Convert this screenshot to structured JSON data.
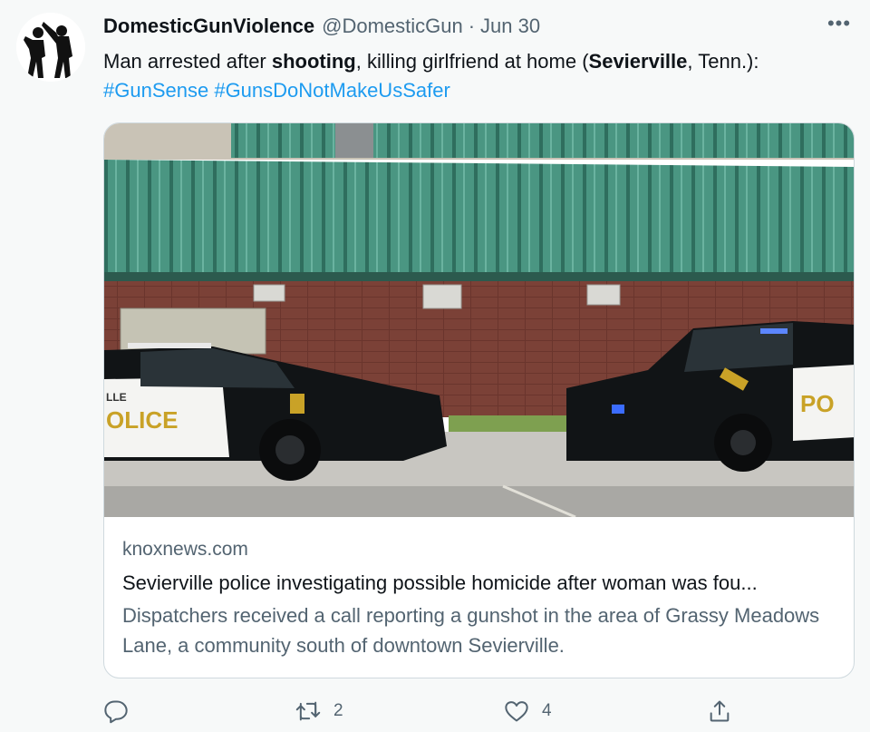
{
  "author": {
    "display_name": "DomesticGunViolence",
    "handle": "@DomesticGun",
    "separator": "·",
    "date": "Jun 30"
  },
  "more_label": "•••",
  "text": {
    "part1": "Man arrested after ",
    "bold1": "shooting",
    "part2": ", killing girlfriend at home (",
    "bold2": "Sevierville",
    "part3": ", Tenn.):",
    "hashtag1": "#GunSense",
    "hashtag2": "#GunsDoNotMakeUsSafer"
  },
  "card": {
    "domain": "knoxnews.com",
    "title": "Sevierville police investigating possible homicide after woman was fou...",
    "description": "Dispatchers received a call reporting a gunshot in the area of Grassy Meadows Lane, a community south of downtown Sevierville.",
    "car_left_text": "OLICE",
    "car_left_small": "LLE",
    "car_right_text": "PO"
  },
  "actions": {
    "reply_count": "",
    "retweet_count": "2",
    "like_count": "4"
  },
  "icons": [
    "avatar-silhouette",
    "more-icon",
    "reply-icon",
    "retweet-icon",
    "like-icon",
    "share-icon"
  ],
  "colors": {
    "link": "#1d9bf0",
    "secondary_text": "#536471",
    "roof": "#3f8a78",
    "brick": "#7b4137",
    "car_body": "#111416",
    "police_gold": "#c9a227"
  }
}
